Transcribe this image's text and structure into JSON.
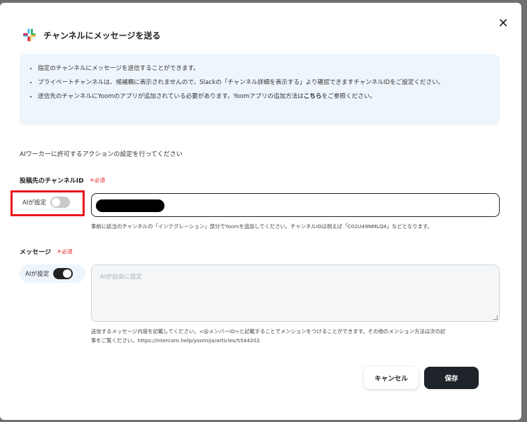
{
  "dialog": {
    "title": "チャンネルにメッセージを送る",
    "close_symbol": "✕"
  },
  "info": {
    "items": [
      "指定のチャンネルにメッセージを送信することができます。",
      "プライベートチャンネルは、候補欄に表示されませんので、Slackの「チャンネル詳細を表示する」より確認できますチャンネルIDをご設定ください。",
      "送信先のチャンネルにYoomのアプリが追加されている必要があります。Yoomアプリの追加方法は"
    ],
    "link_text": "こちら",
    "link_suffix": "をご参照ください。"
  },
  "description": "AIワーカーに許可するアクションの設定を行ってください",
  "channel_field": {
    "label": "投稿先のチャンネルID",
    "required": "＊必須",
    "ai_label": "AIが設定",
    "ai_enabled": false,
    "value_redacted": true,
    "hint": "事前に該当のチャンネルの「インテグレーション」部分でYoomを追加してください。チャンネルIDは例えば「C02U49NMLQ4」などとなります。"
  },
  "message_field": {
    "label": "メッセージ",
    "required": "＊必須",
    "ai_label": "AIが設定",
    "ai_enabled": true,
    "placeholder": "AIが自由に設定",
    "hint_line1": "送信するメッセージ内容を記載してください。<@メンバーID>と記載することでメンションをつけることができます。その他のメンション方法は次の記",
    "hint_line2": "事をご覧ください。https://intercom.help/yoom/ja/articles/5544202"
  },
  "buttons": {
    "cancel": "キャンセル",
    "save": "保存"
  },
  "colors": {
    "highlight": "#e8161a",
    "required": "#e0231c",
    "info_bg": "#eef5fb",
    "save_bg": "#1e2429"
  },
  "icons": {
    "app": "slack-logo-icon",
    "close": "close-icon"
  }
}
